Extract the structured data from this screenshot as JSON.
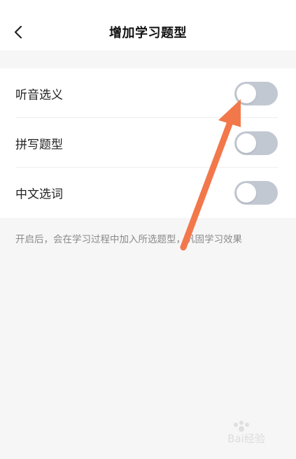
{
  "header": {
    "back_icon": "chevron-left-icon",
    "title": "增加学习题型"
  },
  "options": [
    {
      "label": "听音选义",
      "enabled": false
    },
    {
      "label": "拼写题型",
      "enabled": false
    },
    {
      "label": "中文选词",
      "enabled": false
    }
  ],
  "hint": "开启后，会在学习过程中加入所选题型，巩固学习效果",
  "colors": {
    "background": "#f6f6f6",
    "surface": "#ffffff",
    "toggle_off": "#c2c8d2",
    "annotation_arrow": "#f2784b"
  },
  "watermark": "Bai经验"
}
